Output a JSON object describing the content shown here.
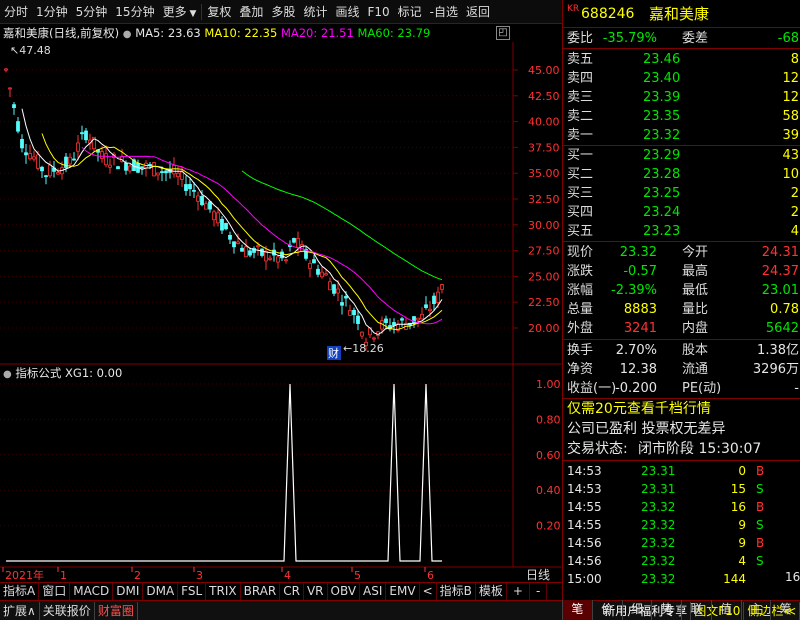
{
  "toolbar": {
    "items": [
      "分时",
      "1分钟",
      "5分钟",
      "15分钟",
      "更多",
      "复权",
      "叠加",
      "多股",
      "统计",
      "画线",
      "F10",
      "标记",
      "-自选",
      "返回"
    ]
  },
  "stock_header": {
    "name_mode": "嘉和美康(日线,前复权)",
    "ma5": "MA5: 23.63",
    "ma10": "MA10: 22.35",
    "ma20": "MA20: 21.51",
    "ma60": "MA60: 23.79",
    "colors": {
      "ma5": "#ffffff",
      "ma10": "#ffff00",
      "ma20": "#ff00ff",
      "ma60": "#00ff00"
    }
  },
  "price_chart": {
    "y_ticks": [
      "45.00",
      "42.50",
      "40.00",
      "37.50",
      "35.00",
      "32.50",
      "30.00",
      "27.50",
      "25.00",
      "22.50",
      "20.00"
    ],
    "high_label": "47.48",
    "low_label": "18.26",
    "event_marker": "财"
  },
  "indicator_panel": {
    "title": "指标公式",
    "value": "XG1: 0.00",
    "y_ticks": [
      "1.00",
      "0.80",
      "0.60",
      "0.40",
      "0.20"
    ]
  },
  "time_axis": {
    "labels": [
      "2021年",
      "1",
      "2",
      "3",
      "4",
      "5",
      "6"
    ],
    "period": "日线"
  },
  "indicator_tabs": [
    "指标A",
    "窗口",
    "MACD",
    "DMI",
    "DMA",
    "FSL",
    "TRIX",
    "BRAR",
    "CR",
    "VR",
    "OBV",
    "ASI",
    "EMV",
    "<",
    "指标B",
    "模板",
    "+",
    "-"
  ],
  "status_bar": {
    "items": [
      "扩展∧",
      "关联报价",
      "财富圈"
    ],
    "right_items": [
      "新用户福利专享",
      "图文F10",
      "侧边栏≪"
    ]
  },
  "quote": {
    "code": "688246",
    "name": "嘉和美康",
    "market_badge": "KR",
    "weibi_label": "委比",
    "weibi": "-35.79%",
    "weicha_label": "委差",
    "weicha": "-68",
    "asks": [
      {
        "label": "卖五",
        "price": "23.46",
        "vol": "8"
      },
      {
        "label": "卖四",
        "price": "23.40",
        "vol": "12"
      },
      {
        "label": "卖三",
        "price": "23.39",
        "vol": "12"
      },
      {
        "label": "卖二",
        "price": "23.35",
        "vol": "58"
      },
      {
        "label": "卖一",
        "price": "23.32",
        "vol": "39"
      }
    ],
    "bids": [
      {
        "label": "买一",
        "price": "23.29",
        "vol": "43"
      },
      {
        "label": "买二",
        "price": "23.28",
        "vol": "10"
      },
      {
        "label": "买三",
        "price": "23.25",
        "vol": "2"
      },
      {
        "label": "买四",
        "price": "23.24",
        "vol": "2"
      },
      {
        "label": "买五",
        "price": "23.23",
        "vol": "4"
      }
    ],
    "stats": [
      {
        "l1": "现价",
        "v1": "23.32",
        "c1": "green",
        "l2": "今开",
        "v2": "24.31",
        "c2": "red"
      },
      {
        "l1": "涨跌",
        "v1": "-0.57",
        "c1": "green",
        "l2": "最高",
        "v2": "24.37",
        "c2": "red"
      },
      {
        "l1": "涨幅",
        "v1": "-2.39%",
        "c1": "green",
        "l2": "最低",
        "v2": "23.01",
        "c2": "green"
      },
      {
        "l1": "总量",
        "v1": "8883",
        "c1": "yellow",
        "l2": "量比",
        "v2": "0.78",
        "c2": "yellow"
      },
      {
        "l1": "外盘",
        "v1": "3241",
        "c1": "red",
        "l2": "内盘",
        "v2": "5642",
        "c2": "green"
      }
    ],
    "stats2": [
      {
        "l1": "换手",
        "v1": "2.70%",
        "l2": "股本",
        "v2": "1.38亿"
      },
      {
        "l1": "净资",
        "v1": "12.38",
        "l2": "流通",
        "v2": "3296万"
      },
      {
        "l1": "收益(一)",
        "v1": "-0.200",
        "l2": "PE(动)",
        "v2": "-"
      }
    ],
    "promo": "仅需20元查看千档行情",
    "info1": "公司已盈利 投票权无差异",
    "trade_status_label": "交易状态:",
    "trade_status": "闭市阶段 15:30:07",
    "ticks": [
      {
        "t": "14:53",
        "p": "23.31",
        "v": "0",
        "s": "B"
      },
      {
        "t": "14:53",
        "p": "23.31",
        "v": "15",
        "s": "S"
      },
      {
        "t": "14:55",
        "p": "23.32",
        "v": "16",
        "s": "B"
      },
      {
        "t": "14:55",
        "p": "23.32",
        "v": "9",
        "s": "S"
      },
      {
        "t": "14:56",
        "p": "23.32",
        "v": "9",
        "s": "B"
      },
      {
        "t": "14:56",
        "p": "23.32",
        "v": "4",
        "s": "S"
      },
      {
        "t": "15:00",
        "p": "23.32",
        "v": "144",
        "s": ""
      }
    ],
    "tick_page": "16"
  },
  "right_tabs": [
    "笔",
    "价",
    "细",
    "势",
    "联",
    "值",
    "主",
    "筹"
  ]
}
